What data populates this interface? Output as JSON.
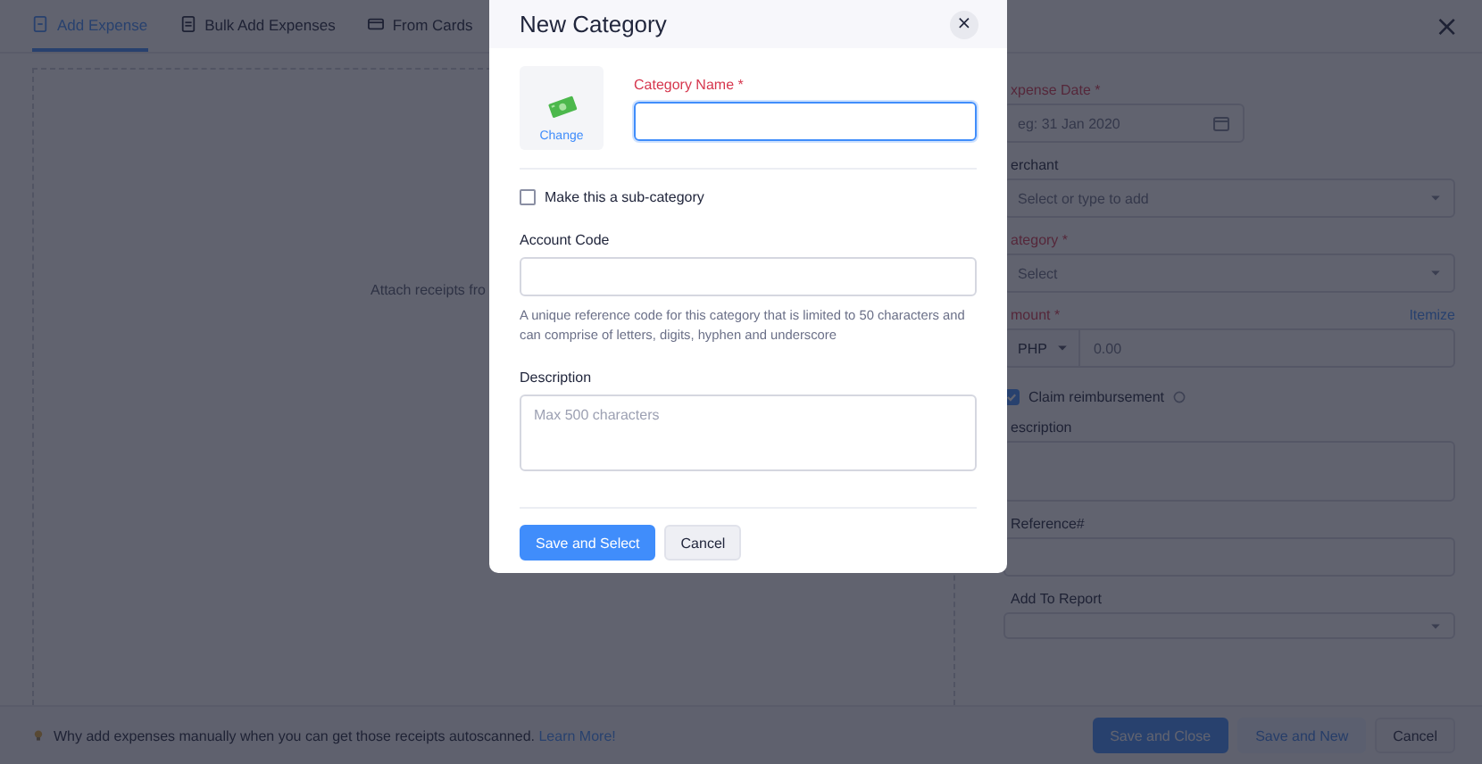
{
  "tabs": [
    {
      "label": "Add Expense",
      "selected": true
    },
    {
      "label": "Bulk Add Expenses",
      "selected": false
    },
    {
      "label": "From Cards",
      "selected": false
    }
  ],
  "close_label": "×",
  "attach_area": {
    "text": "Attach receipts fro"
  },
  "expense_form": [
    {
      "kind": "date",
      "label": "xpense Date *",
      "required": true,
      "placeholder": "eg: 31 Jan 2020"
    },
    {
      "kind": "select",
      "label": "erchant",
      "required": false,
      "placeholder": "Select or type to add"
    },
    {
      "kind": "select",
      "label": "ategory *",
      "required": true,
      "placeholder": "Select"
    },
    {
      "kind": "amount",
      "label": "mount *",
      "required": true,
      "currency": "PHP",
      "placeholder": "0.00",
      "link": "Itemize"
    },
    {
      "kind": "checkbox",
      "label": "Claim reimbursement",
      "checked": true
    },
    {
      "kind": "textarea",
      "label": "escription",
      "required": false
    },
    {
      "kind": "text",
      "label": "Reference#",
      "required": false
    },
    {
      "kind": "select",
      "label": "Add To Report",
      "required": false
    }
  ],
  "footer": {
    "hint": "Why add expenses manually when you can get those receipts autoscanned.",
    "link": "Learn More!",
    "buttons": [
      {
        "label": "Save and Close",
        "kind": "primary"
      },
      {
        "label": "Save and New",
        "kind": "secondary"
      },
      {
        "label": "Cancel",
        "kind": "plain"
      }
    ]
  },
  "dialog": {
    "title": "New Category",
    "close": "×",
    "change_link": "Change",
    "name_label": "Category Name *",
    "subcategory": {
      "label": "Make this a sub-category",
      "checked": false
    },
    "account_code": {
      "label": "Account Code",
      "help": "A unique reference code for this category that is limited to 50 characters and can comprise of letters, digits, hyphen and underscore"
    },
    "description": {
      "label": "Description",
      "placeholder": "Max 500 characters"
    },
    "buttons": [
      {
        "label": "Save and Select",
        "kind": "primary"
      },
      {
        "label": "Cancel",
        "kind": "plain"
      }
    ]
  }
}
